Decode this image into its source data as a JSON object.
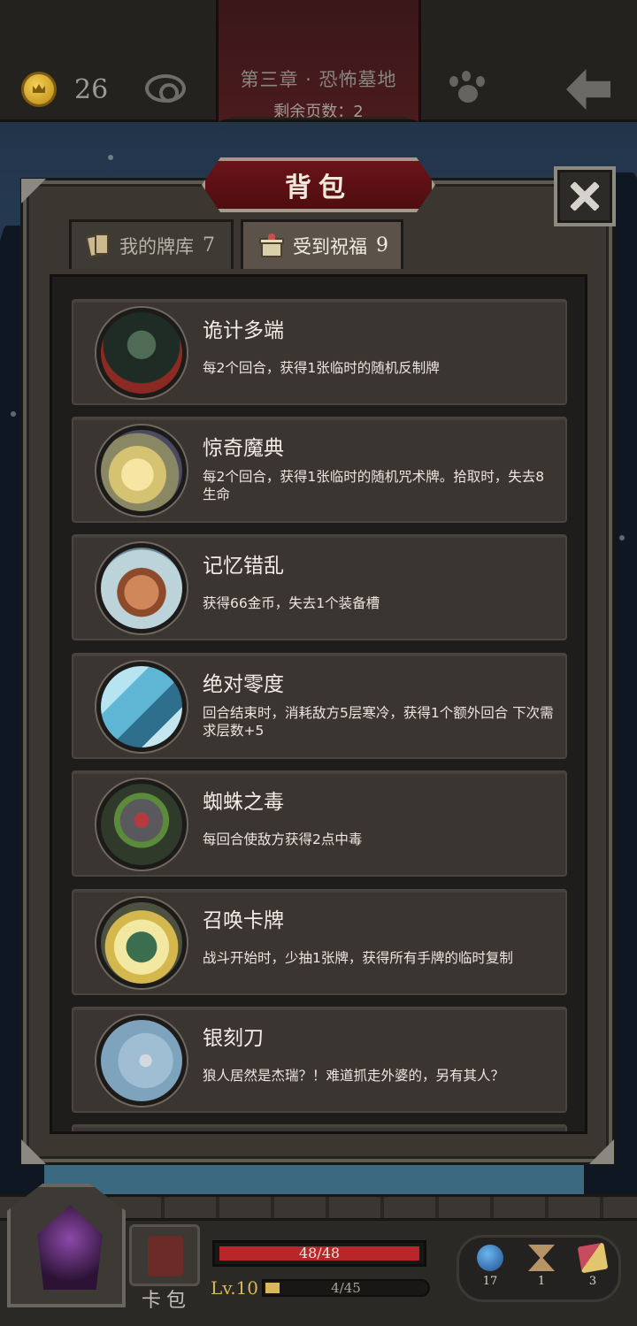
{
  "topbar": {
    "coins": "26",
    "chapter_title": "第三章 · 恐怖墓地",
    "pages_left": "剩余页数：2"
  },
  "panel": {
    "title": "背包",
    "tabs": [
      {
        "label": "我的牌库",
        "count": "7",
        "active": false
      },
      {
        "label": "受到祝福",
        "count": "9",
        "active": true
      }
    ]
  },
  "blessings": [
    {
      "name": "诡计多端",
      "desc": "每2个回合，获得1张临时的随机反制牌"
    },
    {
      "name": "惊奇魔典",
      "desc": "每2个回合，获得1张临时的随机咒术牌。拾取时，失去8生命"
    },
    {
      "name": "记忆错乱",
      "desc": "获得66金币，失去1个装备槽"
    },
    {
      "name": "绝对零度",
      "desc": "回合结束时，消耗敌方5层寒冷，获得1个额外回合 下次需求层数+5"
    },
    {
      "name": "蜘蛛之毒",
      "desc": "每回合使敌方获得2点中毒"
    },
    {
      "name": "召唤卡牌",
      "desc": "战斗开始时，少抽1张牌，获得所有手牌的临时复制"
    },
    {
      "name": "银刻刀",
      "desc": "狼人居然是杰瑞？！难道抓走外婆的，另有其人？"
    }
  ],
  "hud": {
    "deck_label": "卡包",
    "hp_text": "48/48",
    "hp_fraction": 1.0,
    "level_text": "Lv.10",
    "xp_text": "4/45",
    "xp_fraction": 0.09,
    "potions": "17",
    "hourglass": "1",
    "cards": "3"
  },
  "colors": {
    "hp_bar": "#b8262a",
    "title_badge": "#6b1418",
    "level_gold": "#d8b85a"
  }
}
